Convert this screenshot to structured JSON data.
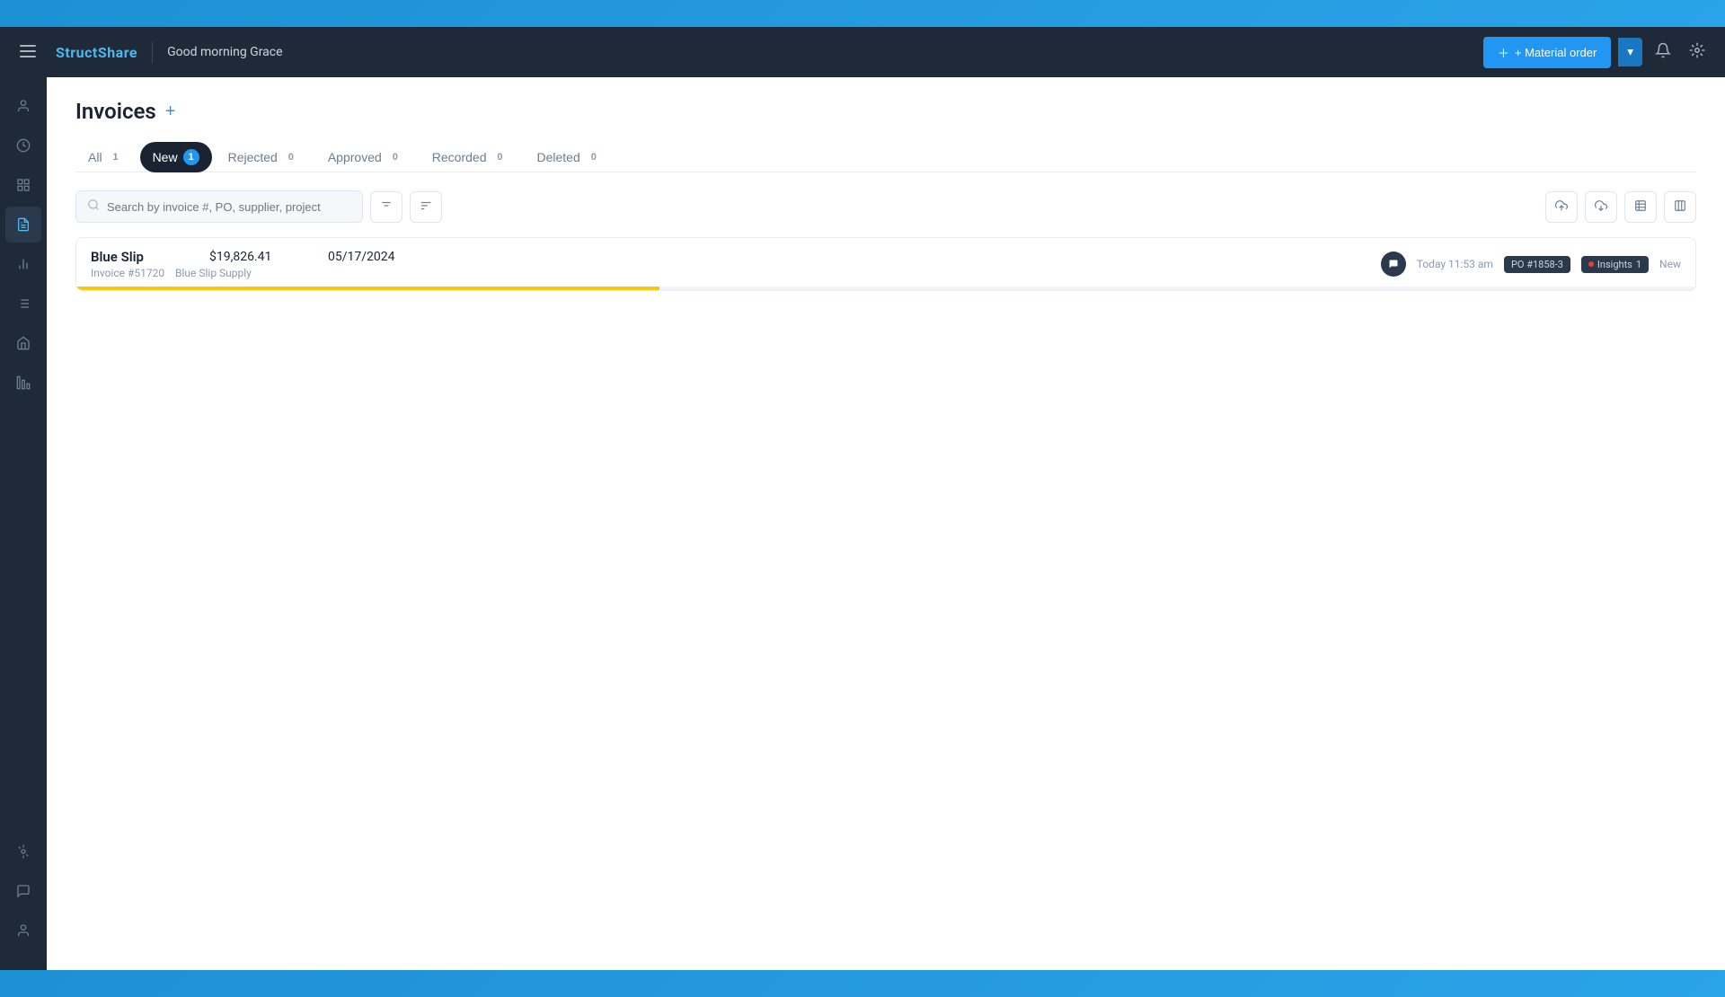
{
  "app": {
    "name_part1": "Struct",
    "name_part2": "Share"
  },
  "header": {
    "greeting": "Good morning Grace",
    "material_order_btn": "+ Material order",
    "dropdown_arrow": "▾"
  },
  "sidebar": {
    "items": [
      {
        "id": "menu",
        "icon": "☰",
        "label": "menu-icon"
      },
      {
        "id": "user",
        "icon": "👤",
        "label": "user-icon"
      },
      {
        "id": "history",
        "icon": "🕐",
        "label": "history-icon"
      },
      {
        "id": "grid",
        "icon": "⊞",
        "label": "grid-icon"
      },
      {
        "id": "document",
        "icon": "📄",
        "label": "document-icon"
      },
      {
        "id": "chart",
        "icon": "📊",
        "label": "chart-icon"
      },
      {
        "id": "list",
        "icon": "☰",
        "label": "list-icon"
      },
      {
        "id": "home",
        "icon": "🏠",
        "label": "home-icon"
      },
      {
        "id": "bar-chart",
        "icon": "▦",
        "label": "bar-chart-icon"
      }
    ],
    "bottom_items": [
      {
        "id": "settings",
        "icon": "⚙",
        "label": "settings-icon"
      },
      {
        "id": "chat",
        "icon": "💬",
        "label": "chat-icon"
      },
      {
        "id": "profile",
        "icon": "👤",
        "label": "profile-icon"
      }
    ]
  },
  "page": {
    "title": "Invoices",
    "add_btn": "+",
    "tabs": [
      {
        "id": "all",
        "label": "All",
        "count": "1",
        "active": false
      },
      {
        "id": "new",
        "label": "New",
        "count": "1",
        "active": true
      },
      {
        "id": "rejected",
        "label": "Rejected",
        "count": "0",
        "active": false
      },
      {
        "id": "approved",
        "label": "Approved",
        "count": "0",
        "active": false
      },
      {
        "id": "recorded",
        "label": "Recorded",
        "count": "0",
        "active": false
      },
      {
        "id": "deleted",
        "label": "Deleted",
        "count": "0",
        "active": false
      }
    ]
  },
  "toolbar": {
    "search_placeholder": "Search by invoice #, PO, supplier, project",
    "filter_icon": "≡",
    "sort_icon": "⇅",
    "upload_icon": "⬆",
    "download_icon": "⬇",
    "table_icon": "⊞",
    "columns_icon": "⊟"
  },
  "invoices": [
    {
      "id": "inv-1",
      "name": "Blue Slip",
      "amount": "$19,826.41",
      "date": "05/17/2024",
      "invoice_number": "Invoice #51720",
      "supplier": "Blue Slip Supply",
      "comment_icon": "💬",
      "timestamp": "Today 11:53 am",
      "po_badge": "PO #1858-3",
      "insights_badge": "Insights",
      "insights_count": "1",
      "status": "New",
      "progress": 36
    }
  ]
}
